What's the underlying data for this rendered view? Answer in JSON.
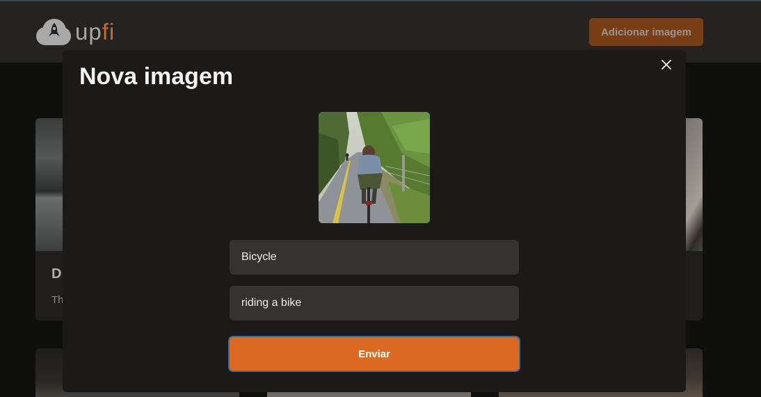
{
  "header": {
    "logo_up": "up",
    "logo_fi": "fi",
    "logo_icon": "cloud-rocket-icon",
    "add_button_label": "Adicionar imagem"
  },
  "background_card": {
    "title_fragment": "D",
    "description_fragment": "Th"
  },
  "modal": {
    "title": "Nova imagem",
    "close_icon": "close-icon",
    "preview_image": "person riding a bicycle on a tree-lined path",
    "title_field": {
      "value": "Bicycle"
    },
    "description_field": {
      "value": "riding a bike"
    },
    "submit_label": "Enviar"
  },
  "colors": {
    "accent": "#dc6a22",
    "accent_dim": "#7a3e17",
    "modal_bg": "#1b1a19",
    "input_bg": "#353331",
    "focus_ring": "#3f6b95"
  }
}
